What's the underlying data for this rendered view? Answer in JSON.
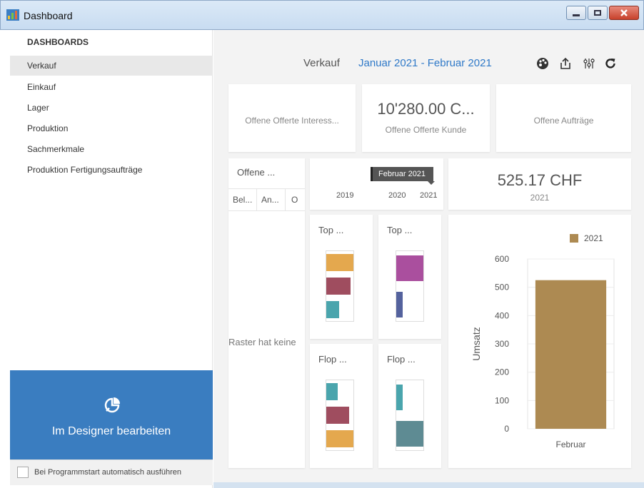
{
  "window": {
    "title": "Dashboard"
  },
  "sidebar": {
    "header": "DASHBOARDS",
    "items": [
      {
        "label": "Verkauf",
        "active": true
      },
      {
        "label": "Einkauf"
      },
      {
        "label": "Lager"
      },
      {
        "label": "Produktion"
      },
      {
        "label": "Sachmerkmale"
      },
      {
        "label": "Produktion Fertigungsaufträge"
      }
    ],
    "designer_label": "Im Designer bearbeiten",
    "autostart_label": "Bei Programmstart automatisch ausführen"
  },
  "header": {
    "dashboard_name": "Verkauf",
    "date_range": "Januar 2021 - Februar 2021",
    "tools": [
      "palette-icon",
      "export-icon",
      "filter-settings-icon",
      "refresh-icon"
    ]
  },
  "cards": {
    "offers_interest": {
      "label": "Offene Offerte Interess..."
    },
    "offers_customer": {
      "value": "10'280.00 C...",
      "label": "Offene Offerte Kunde"
    },
    "open_orders": {
      "label": "Offene Aufträge"
    },
    "offene_grid": {
      "title": "Offene ...",
      "columns": [
        "Bel...",
        "An...",
        "O"
      ],
      "empty_text": "Raster hat keine"
    },
    "timeline": {
      "tooltip": "Februar 2021",
      "years": [
        "2019",
        "2020",
        "2021"
      ]
    },
    "kpi_2021": {
      "value": "525.17 CHF",
      "label": "2021"
    },
    "top1": {
      "title": "Top ..."
    },
    "top2": {
      "title": "Top ..."
    },
    "flop1": {
      "title": "Flop ..."
    },
    "flop2": {
      "title": "Flop ..."
    }
  },
  "colors": {
    "accent_blue": "#2f79c8",
    "designer_blue": "#3a7dc0",
    "bar_gold": "#ad8a52",
    "orange": "#e4a84e",
    "maroon": "#9f4d5f",
    "teal": "#4aa5ad",
    "purple": "#aa4f9e",
    "navy": "#54629d",
    "slate_teal": "#5e8b93"
  },
  "chart_data": {
    "type": "bar",
    "categories": [
      "Februar"
    ],
    "series": [
      {
        "name": "2021",
        "values": [
          525.17
        ]
      }
    ],
    "ylabel": "Umsatz",
    "ylim": [
      0,
      600
    ],
    "yticks": [
      0,
      100,
      200,
      300,
      400,
      500,
      600
    ],
    "grid": true,
    "legend": "top-right"
  }
}
